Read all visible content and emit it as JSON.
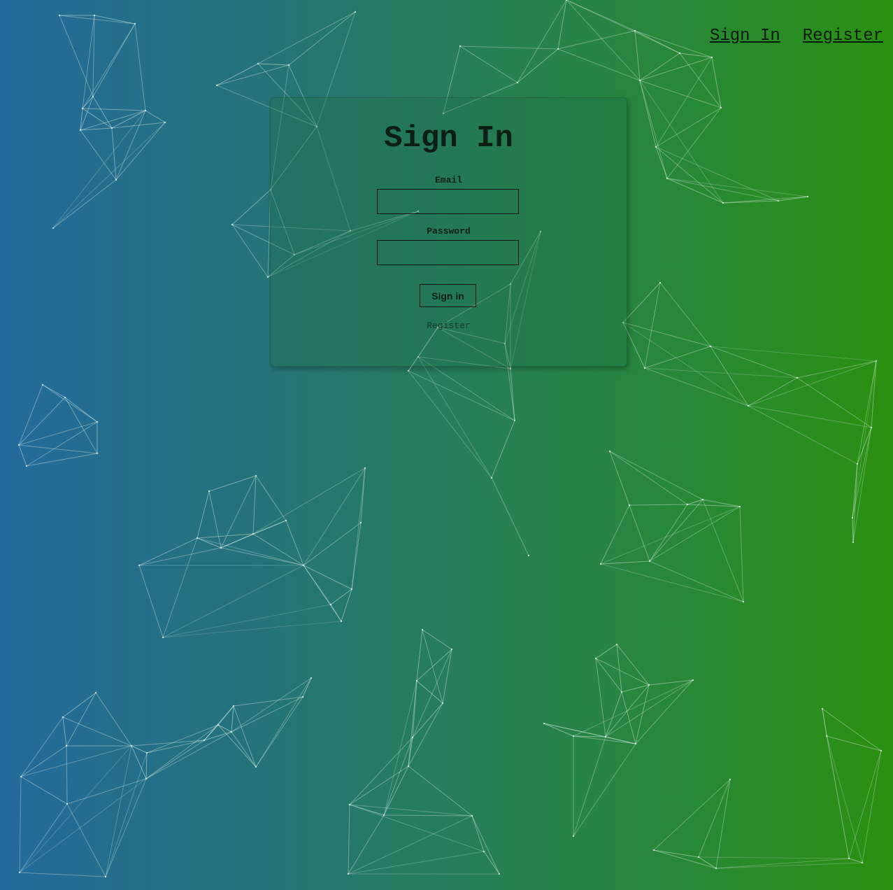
{
  "nav": {
    "sign_in": "Sign In",
    "register": "Register"
  },
  "card": {
    "title": "Sign In",
    "email_label": "Email",
    "email_value": "",
    "password_label": "Password",
    "password_value": "",
    "submit_label": "Sign in",
    "register_link": "Register"
  },
  "colors": {
    "gradient_left": "#236a9c",
    "gradient_right": "#2a9010",
    "network_lines": "#dfefe6"
  },
  "background": {
    "effect": "particle-network"
  }
}
